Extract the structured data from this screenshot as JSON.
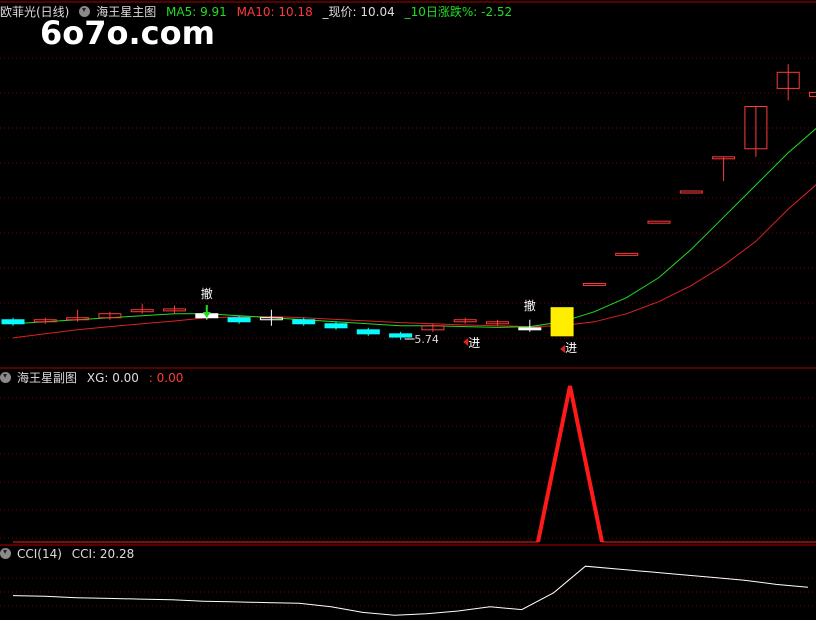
{
  "main_panel": {
    "stock_name": "欧菲光(日线)",
    "indicator_name": "海王星主图",
    "ma5_label": "MA5: 9.91",
    "ma10_label": "MA10: 10.18",
    "price_label": "_现价: 10.04",
    "change_label": "_10日涨跌%: -2.52",
    "low_price_label": "5.74",
    "signal_labels": [
      "撤",
      "撤",
      "进",
      "进"
    ]
  },
  "sub_panel": {
    "indicator_name": "海王星副图",
    "xg_label": "XG: 0.00",
    "xg_value2": ": 0.00"
  },
  "cci_panel": {
    "indicator_name": "CCI(14)",
    "cci_label": "CCI: 20.28"
  },
  "watermark": "6o7o.com",
  "colors": {
    "up": "#ff3a3a",
    "down": "#00ffff",
    "ma5": "#22dd22",
    "ma10": "#dd2222",
    "signal_yellow": "#ffee00",
    "xg_line": "#ff1a1a",
    "cci_line": "#ffffff",
    "grid": "#7a0000"
  },
  "chart_data": [
    {
      "type": "candlestick",
      "title": "海王星主图",
      "candles": [
        {
          "o": 6.55,
          "c": 6.45,
          "h": 6.6,
          "l": 6.4
        },
        {
          "o": 6.5,
          "c": 6.55,
          "h": 6.6,
          "l": 6.45
        },
        {
          "o": 6.55,
          "c": 6.6,
          "h": 6.8,
          "l": 6.5
        },
        {
          "o": 6.6,
          "c": 6.7,
          "h": 6.75,
          "l": 6.55
        },
        {
          "o": 6.75,
          "c": 6.8,
          "h": 6.95,
          "l": 6.7
        },
        {
          "o": 6.78,
          "c": 6.82,
          "h": 6.9,
          "l": 6.7
        },
        {
          "o": 6.7,
          "c": 6.6,
          "h": 6.75,
          "l": 6.55
        },
        {
          "o": 6.6,
          "c": 6.5,
          "h": 6.65,
          "l": 6.45
        },
        {
          "o": 6.6,
          "c": 6.6,
          "h": 6.8,
          "l": 6.4
        },
        {
          "o": 6.55,
          "c": 6.45,
          "h": 6.6,
          "l": 6.4
        },
        {
          "o": 6.45,
          "c": 6.35,
          "h": 6.5,
          "l": 6.3
        },
        {
          "o": 6.3,
          "c": 6.2,
          "h": 6.35,
          "l": 6.15
        },
        {
          "o": 6.2,
          "c": 6.12,
          "h": 6.25,
          "l": 6.05
        },
        {
          "o": 6.3,
          "c": 6.4,
          "h": 6.45,
          "l": 6.25
        },
        {
          "o": 6.5,
          "c": 6.55,
          "h": 6.6,
          "l": 6.45
        },
        {
          "o": 6.45,
          "c": 6.5,
          "h": 6.55,
          "l": 6.4
        },
        {
          "o": 6.35,
          "c": 6.3,
          "h": 6.55,
          "l": 6.25
        },
        {
          "o": 6.15,
          "c": 6.85,
          "h": 6.85,
          "l": 6.15
        },
        {
          "o": 7.45,
          "c": 7.45,
          "h": 7.45,
          "l": 7.45
        },
        {
          "o": 8.2,
          "c": 8.2,
          "h": 8.2,
          "l": 8.2
        },
        {
          "o": 9.0,
          "c": 9.0,
          "h": 9.0,
          "l": 9.0
        },
        {
          "o": 9.75,
          "c": 9.75,
          "h": 9.75,
          "l": 9.75
        },
        {
          "o": 10.6,
          "c": 10.6,
          "h": 10.6,
          "l": 10.0
        },
        {
          "o": 10.8,
          "c": 11.85,
          "h": 11.85,
          "l": 10.6
        },
        {
          "o": 12.3,
          "c": 12.7,
          "h": 12.9,
          "l": 12.0
        },
        {
          "o": 12.1,
          "c": 12.2,
          "h": 12.4,
          "l": 11.8
        }
      ],
      "ma5": [
        6.45,
        6.5,
        6.55,
        6.6,
        6.65,
        6.7,
        6.7,
        6.65,
        6.6,
        6.55,
        6.5,
        6.45,
        6.4,
        6.4,
        6.38,
        6.36,
        6.38,
        6.5,
        6.75,
        7.1,
        7.6,
        8.3,
        9.1,
        9.9,
        10.7,
        11.4
      ],
      "ma10": [
        6.1,
        6.2,
        6.3,
        6.38,
        6.45,
        6.52,
        6.6,
        6.62,
        6.63,
        6.6,
        6.56,
        6.52,
        6.48,
        6.45,
        6.42,
        6.4,
        6.38,
        6.4,
        6.5,
        6.7,
        7.0,
        7.4,
        7.9,
        8.5,
        9.3,
        10.0
      ],
      "low_marker": 5.74,
      "ylim": [
        5.5,
        14.0
      ]
    },
    {
      "type": "line",
      "title": "海王星副图",
      "series": [
        {
          "name": "XG",
          "values": [
            0,
            0,
            0,
            0,
            0,
            0,
            0,
            0,
            0,
            0,
            0,
            0,
            0,
            0,
            0,
            0,
            0,
            0,
            0,
            1,
            0,
            0,
            0,
            0,
            0,
            0
          ]
        }
      ],
      "ylim": [
        0,
        1
      ]
    },
    {
      "type": "line",
      "title": "CCI(14)",
      "series": [
        {
          "name": "CCI",
          "values": [
            60,
            55,
            45,
            40,
            35,
            30,
            20,
            15,
            10,
            5,
            -20,
            -60,
            -80,
            -70,
            -50,
            -20,
            -40,
            80,
            270,
            250,
            230,
            210,
            190,
            170,
            140,
            120
          ]
        }
      ],
      "ylim": [
        -100,
        300
      ]
    }
  ]
}
